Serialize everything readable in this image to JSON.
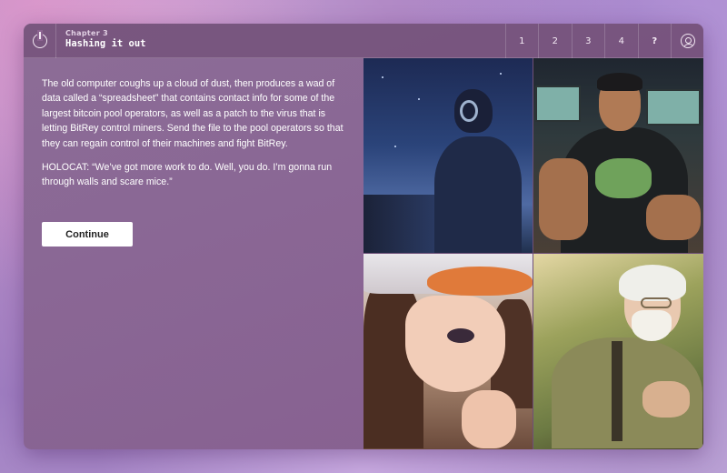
{
  "header": {
    "chapter_label": "Chapter 3",
    "chapter_title": "Hashing it out",
    "nav": [
      "1",
      "2",
      "3",
      "4",
      "?"
    ]
  },
  "story": {
    "paragraph_1": "The old computer coughs up a cloud of dust, then produces a wad of data called a “spreadsheet” that contains contact info for some of the largest bitcoin pool operators, as well as a patch to the virus that is letting BitRey control miners. Send the file to the pool operators so that they can regain control of their machines and fight BitRey.",
    "paragraph_2": "HOLOCAT: “We’ve got more work to do. Well, you do. I’m gonna run through walls and scare mice.”"
  },
  "actions": {
    "continue_label": "Continue"
  },
  "icons": {
    "power": "power-icon",
    "user": "user-icon"
  },
  "colors": {
    "panel": "#8a6795",
    "button_bg": "#ffffff",
    "accent_orange": "#e07a3a"
  }
}
